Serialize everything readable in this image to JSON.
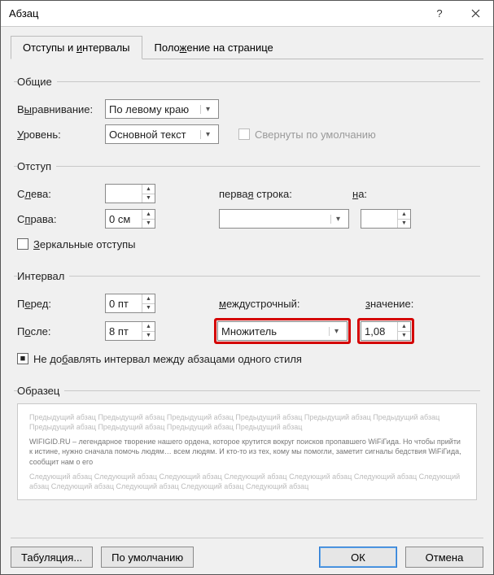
{
  "title": "Абзац",
  "tabs": {
    "t1": "Отступы и интервалы",
    "t2": "Положение на странице"
  },
  "groups": {
    "general": "Общие",
    "indent": "Отступ",
    "spacing": "Интервал",
    "preview": "Образец"
  },
  "labels": {
    "alignment": "Выравнивание:",
    "level": "Уровень:",
    "collapsed": "Свернуты по умолчанию",
    "left": "Слева:",
    "right": "Справа:",
    "special": "первая строка:",
    "by": "на:",
    "mirror": "Зеркальные отступы",
    "before": "Перед:",
    "after": "После:",
    "linespace": "междустрочный:",
    "at": "значение:",
    "nospace": "Не добавлять интервал между абзацами одного стиля"
  },
  "values": {
    "alignment": "По левому краю",
    "level": "Основной текст",
    "left": "",
    "right": "0 см",
    "special": "",
    "by": "",
    "before": "0 пт",
    "after": "8 пт",
    "linespace": "Множитель",
    "at": "1,08"
  },
  "preview": {
    "prev": "Предыдущий абзац Предыдущий абзац Предыдущий абзац Предыдущий абзац Предыдущий абзац Предыдущий абзац Предыдущий абзац Предыдущий абзац Предыдущий абзац Предыдущий абзац",
    "body": "WIFIGID.RU – легендарное творение нашего ордена, которое крутится вокруг поисков пропавшего WiFiГида. Но чтобы прийти к истине, нужно сначала помочь людям… всем людям. И кто-то из тех, кому мы помогли, заметит сигналы бедствия WiFiГида, сообщит нам о его",
    "next": "Следующий абзац Следующий абзац Следующий абзац Следующий абзац Следующий абзац Следующий абзац Следующий абзац Следующий абзац Следующий абзац Следующий абзац Следующий абзац"
  },
  "buttons": {
    "tabs": "Табуляция...",
    "default": "По умолчанию",
    "ok": "ОК",
    "cancel": "Отмена"
  }
}
